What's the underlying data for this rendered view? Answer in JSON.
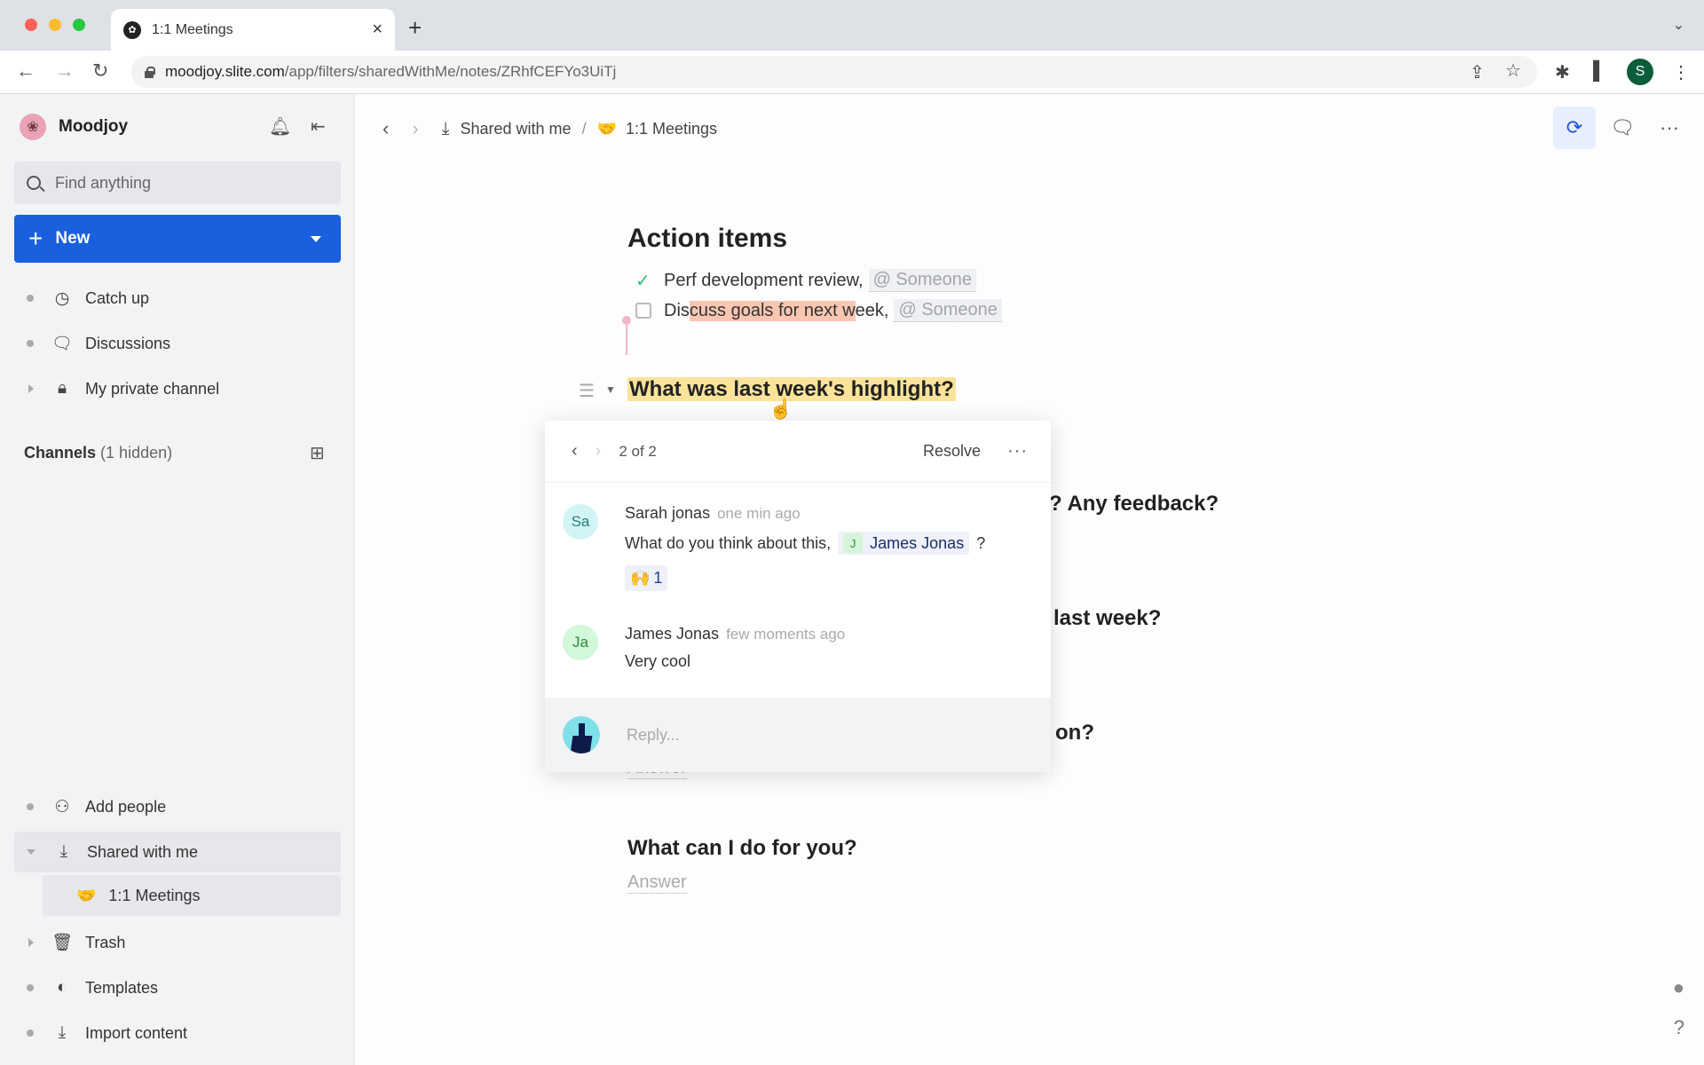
{
  "browser": {
    "tab_title": "1:1 Meetings",
    "tab_close": "×",
    "new_tab": "+",
    "tab_menu": "⌄",
    "url_host": "moodjoy.slite.com",
    "url_path": "/app/filters/sharedWithMe/notes/ZRhfCEFYo3UiTj",
    "profile_initial": "S",
    "icons": {
      "back": "←",
      "forward": "→",
      "reload": "↻",
      "share": "⇪",
      "star": "☆",
      "extensions": "✱",
      "sidepanel": "▌",
      "menu": "⋮"
    }
  },
  "sidebar": {
    "workspace_name": "Moodjoy",
    "workspace_logo": "❀",
    "search_placeholder": "Find anything",
    "new_button": {
      "plus": "+",
      "label": "New"
    },
    "top_items": [
      {
        "label": "Catch up",
        "icon": "🕓"
      },
      {
        "label": "Discussions",
        "icon": "🗨"
      },
      {
        "label": "My private channel",
        "icon": "🔒"
      }
    ],
    "channels_heading": "Channels",
    "channels_hidden": "(1 hidden)",
    "bottom_items": [
      {
        "label": "Add people",
        "icon": "👤"
      },
      {
        "label": "Shared with me",
        "icon": "⤓"
      },
      {
        "label": "Trash",
        "icon": "🗑"
      },
      {
        "label": "Templates",
        "icon": "◐"
      },
      {
        "label": "Import content",
        "icon": "⤓"
      }
    ],
    "sub_item": {
      "label": "1:1 Meetings",
      "emoji": "🤝"
    }
  },
  "header": {
    "breadcrumb": [
      {
        "label": "Shared with me",
        "icon": "⤓"
      },
      {
        "label": "1:1 Meetings",
        "emoji": "🤝"
      }
    ],
    "separator": "/",
    "back": "‹",
    "forward": "›",
    "actions": {
      "history": "⟳",
      "comments": "💬",
      "more": "···"
    }
  },
  "document": {
    "section_title": "Action items",
    "tasks": [
      {
        "done": true,
        "pre": "Perf development review,",
        "mention": "@ Someone"
      },
      {
        "done": false,
        "pre": "Dis",
        "highlight": "cuss goals for next w",
        "post": "eek,",
        "mention": "@ Someone"
      }
    ],
    "questions": [
      {
        "title": "What was last week's highlight?"
      },
      {
        "title_tail": "? Any feedback?"
      },
      {
        "title_tail": "last week?"
      },
      {
        "title_tail": "on?",
        "answer": "Answer"
      },
      {
        "title": "What can I do for you?",
        "answer": "Answer"
      }
    ]
  },
  "comment_popup": {
    "counter": "2 of 2",
    "resolve_label": "Resolve",
    "more": "···",
    "prev": "‹",
    "next": "›",
    "comments": [
      {
        "initials": "Sa",
        "author": "Sarah jonas",
        "time": "one min ago",
        "text": "What do you think about this,",
        "mention_initial": "J",
        "mention_name": "James Jonas",
        "text_after": "?",
        "reaction_emoji": "🙌",
        "reaction_count": "1"
      },
      {
        "initials": "Ja",
        "author": "James Jonas",
        "time": "few moments ago",
        "text": "Very cool"
      }
    ],
    "reply_placeholder": "Reply..."
  },
  "floating": {
    "toggle": "●",
    "help": "?"
  }
}
